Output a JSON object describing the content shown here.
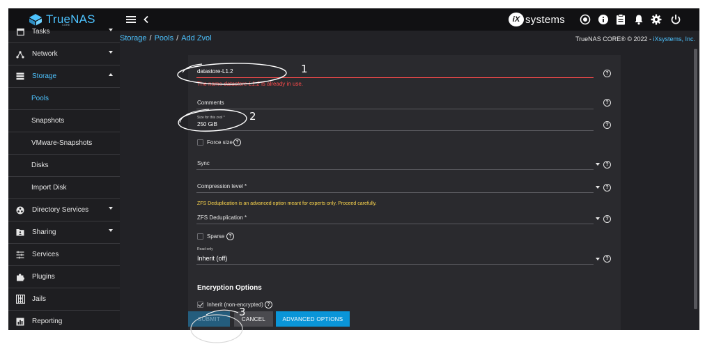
{
  "topbar": {
    "logo_text": "TrueNAS",
    "logo_sub": "CORE",
    "vendor_text": "systems",
    "vendor_mark": "iX",
    "icons": [
      "menu-icon",
      "back-icon",
      "truecommand-icon",
      "info-icon",
      "clipboard-icon",
      "bell-icon",
      "gear-icon",
      "power-icon"
    ]
  },
  "sidebar": {
    "items": [
      {
        "label": "Tasks",
        "icon": "calendar-icon"
      },
      {
        "label": "Network",
        "icon": "network-icon"
      },
      {
        "label": "Storage",
        "icon": "storage-icon"
      },
      {
        "label": "Pools"
      },
      {
        "label": "Snapshots"
      },
      {
        "label": "VMware-Snapshots"
      },
      {
        "label": "Disks"
      },
      {
        "label": "Import Disk"
      },
      {
        "label": "Directory Services",
        "icon": "directory-icon"
      },
      {
        "label": "Sharing",
        "icon": "folder-share-icon"
      },
      {
        "label": "Services",
        "icon": "sliders-icon"
      },
      {
        "label": "Plugins",
        "icon": "puzzle-icon"
      },
      {
        "label": "Jails",
        "icon": "jail-icon"
      },
      {
        "label": "Reporting",
        "icon": "chart-icon"
      }
    ]
  },
  "breadcrumb": {
    "items": [
      "Storage",
      "Pools",
      "Add Zvol"
    ],
    "separator": "/"
  },
  "copyright": {
    "text": "TrueNAS CORE® © 2022 - ",
    "link": "iXsystems, Inc."
  },
  "form": {
    "zvol_name": {
      "value": "datastore-L1.2",
      "error_prefix": "The name ",
      "error_name": "datastore-L1.2",
      "error_suffix": " is already in use."
    },
    "comments": {
      "label": "Comments"
    },
    "size": {
      "label": "Size for this zvol *",
      "value": "250 GiB"
    },
    "force_size": {
      "label": "Force size",
      "checked": false
    },
    "sync": {
      "label": "Sync"
    },
    "compression": {
      "label": "Compression level *"
    },
    "dedup_warning": "ZFS Deduplication is an advanced option meant for experts only. Proceed carefully.",
    "dedup": {
      "label": "ZFS Deduplication *"
    },
    "sparse": {
      "label": "Sparse",
      "checked": false
    },
    "readonly": {
      "label": "Read-only",
      "value": "Inherit (off)"
    },
    "encryption": {
      "title": "Encryption Options",
      "inherit_label": "Inherit (non-encrypted)",
      "inherit_checked": true
    }
  },
  "buttons": {
    "submit": "SUBMIT",
    "cancel": "CANCEL",
    "advanced": "ADVANCED OPTIONS"
  },
  "annotations": {
    "marks": [
      "1",
      "2",
      "3"
    ]
  },
  "colors": {
    "accent": "#4dc3ff",
    "error": "#ff4b4b",
    "warning": "#ffd84d",
    "primary_button": "#0a95d8"
  }
}
